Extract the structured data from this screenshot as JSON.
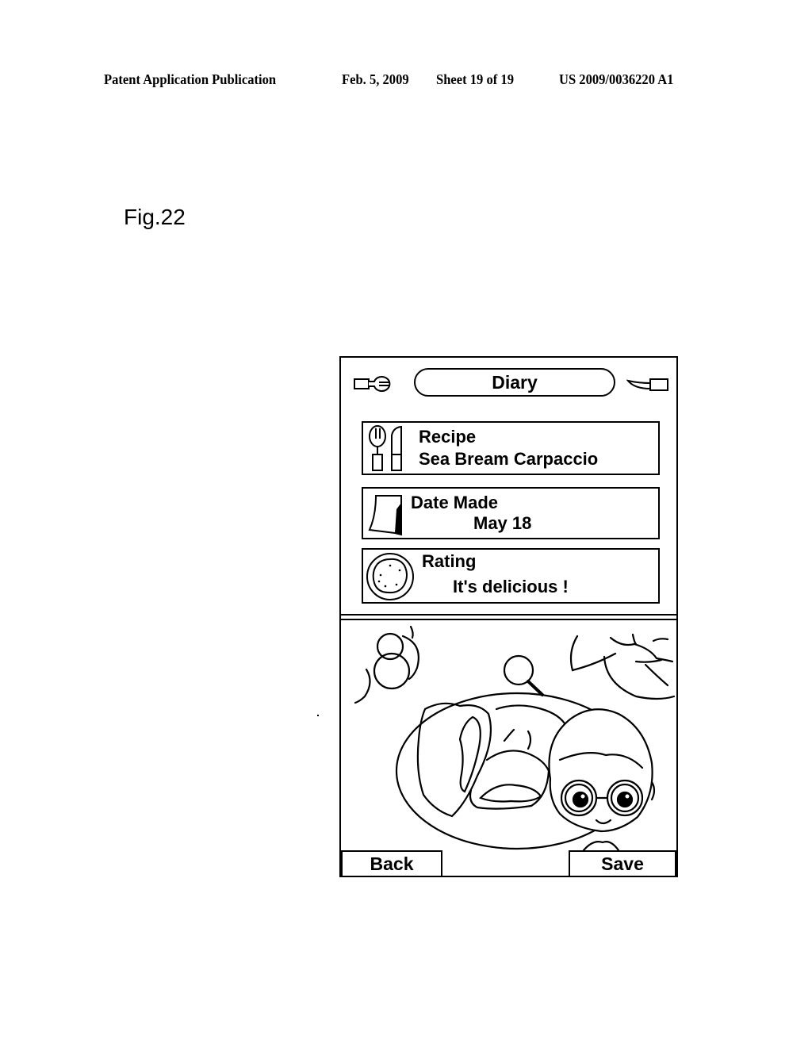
{
  "page_header": {
    "publication": "Patent Application Publication",
    "date": "Feb. 5, 2009",
    "sheet": "Sheet 19 of 19",
    "number": "US 2009/0036220 A1"
  },
  "figure_label": "Fig.22",
  "screen": {
    "title": "Diary",
    "left_icon": "spoon-icon",
    "right_icon": "knife-icon",
    "cards": [
      {
        "icon": "cutlery-icon",
        "label": "Recipe",
        "value": "Sea Bream Carpaccio"
      },
      {
        "icon": "calendar-page-icon",
        "label": "Date Made",
        "value": "May 18"
      },
      {
        "icon": "plate-icon",
        "label": "Rating",
        "value": "It's delicious !"
      }
    ],
    "illustration": "food-plate-with-character",
    "buttons": {
      "back": "Back",
      "save": "Save"
    }
  }
}
